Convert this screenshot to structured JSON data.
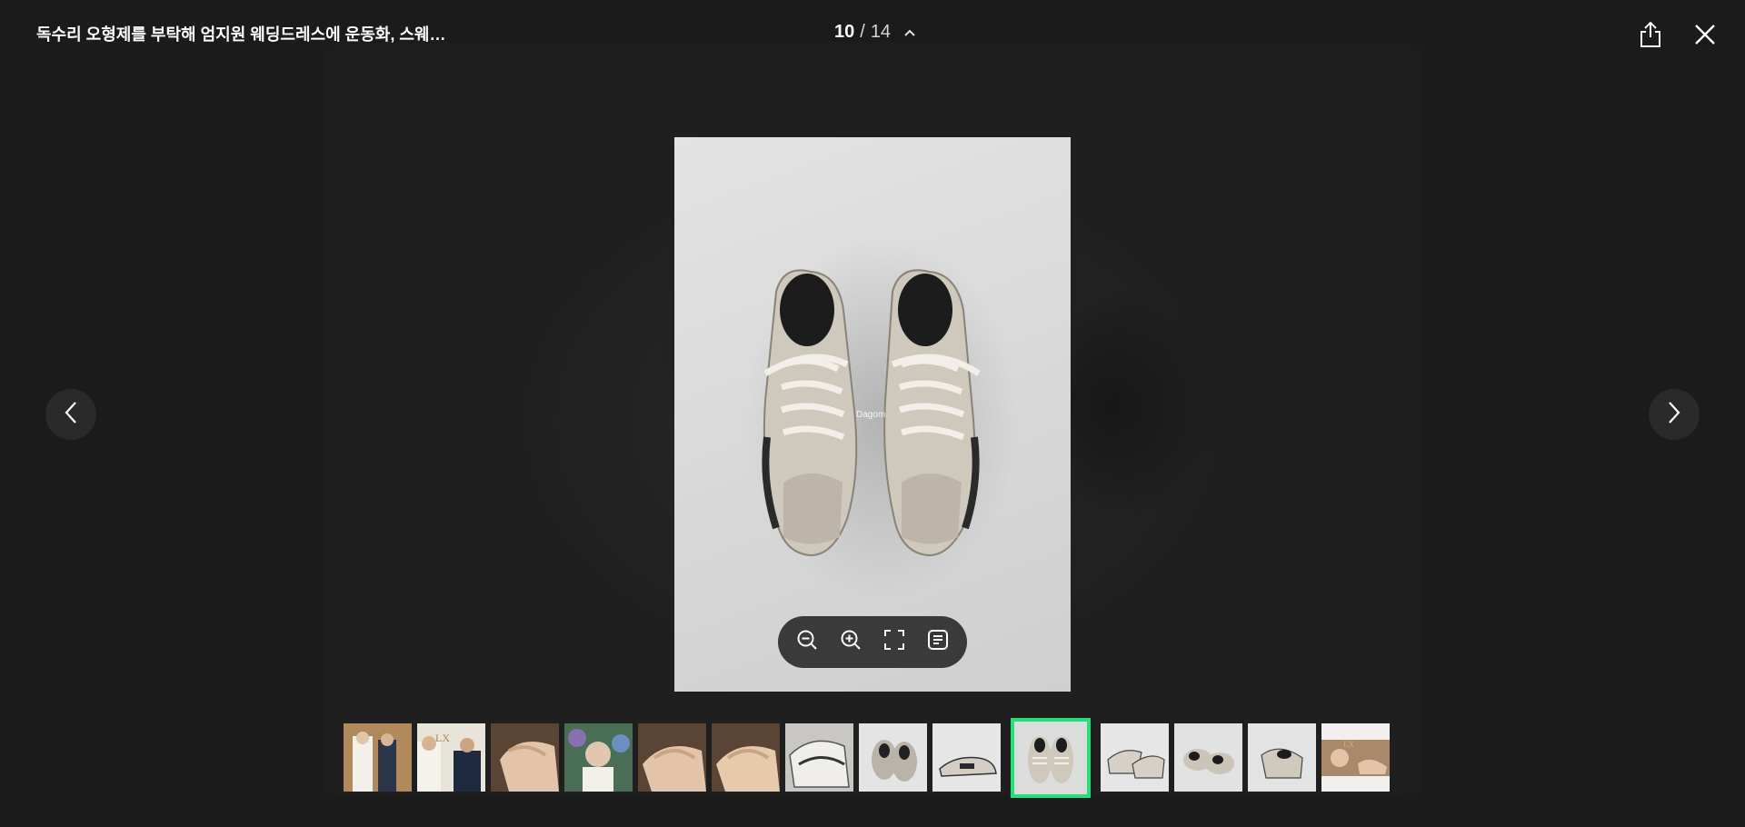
{
  "header": {
    "title": "독수리 오형제를 부탁해 엄지원 웨딩드레스에 운동화, 스웨…",
    "current": "10",
    "separator": "/",
    "total": "14"
  },
  "watermark": "Dagom",
  "icons": {
    "share": "share-icon",
    "close": "close-icon",
    "prev": "chevron-left-icon",
    "next": "chevron-right-icon",
    "collapse": "chevron-up-icon",
    "zoom_out": "zoom-out-icon",
    "zoom_in": "zoom-in-icon",
    "fullscreen": "fullscreen-icon",
    "article": "article-icon"
  },
  "colors": {
    "selected_border": "#22e07a",
    "background": "#1f1f1f"
  },
  "thumbnails": [
    {
      "index": 1,
      "subject": "wedding-couple",
      "selected": false
    },
    {
      "index": 2,
      "subject": "couple-indoor",
      "selected": false
    },
    {
      "index": 3,
      "subject": "shoe-closeup",
      "selected": false
    },
    {
      "index": 4,
      "subject": "bride-flowers",
      "selected": false
    },
    {
      "index": 5,
      "subject": "shoe-closeup",
      "selected": false
    },
    {
      "index": 6,
      "subject": "shoe-closeup",
      "selected": false
    },
    {
      "index": 7,
      "subject": "sneaker-laces",
      "selected": false
    },
    {
      "index": 8,
      "subject": "sneakers-pair",
      "selected": false
    },
    {
      "index": 9,
      "subject": "sneaker-side",
      "selected": false
    },
    {
      "index": 10,
      "subject": "sneakers-topdown",
      "selected": true
    },
    {
      "index": 11,
      "subject": "sneakers-pair",
      "selected": false
    },
    {
      "index": 12,
      "subject": "sneakers-pair",
      "selected": false
    },
    {
      "index": 13,
      "subject": "sneaker-single",
      "selected": false
    },
    {
      "index": 14,
      "subject": "bride-with-text",
      "selected": false
    }
  ]
}
